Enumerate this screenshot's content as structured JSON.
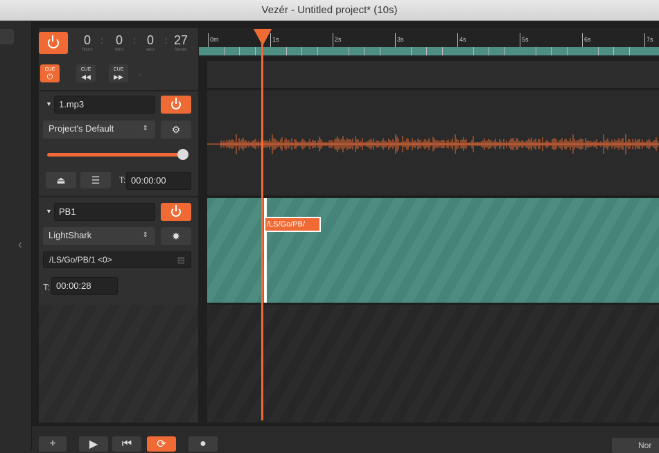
{
  "window": {
    "title": "Vezér - Untitled project* (10s)"
  },
  "transport": {
    "hours": "0",
    "mins": "0",
    "secs": "0",
    "frames": "27",
    "hours_label": "hours",
    "mins_label": "mins",
    "secs_label": "secs",
    "frames_label": "frames",
    "separator": ":"
  },
  "cue_buttons": [
    {
      "label": "CUE",
      "icon": "power-icon",
      "active": true
    },
    {
      "label": "CUE",
      "icon": "rewind-icon",
      "active": false
    },
    {
      "label": "CUE",
      "icon": "fast-forward-icon",
      "active": false
    }
  ],
  "cue_dash": "-",
  "ruler": {
    "labels": [
      "0m",
      "1s",
      "2s",
      "3s",
      "4s",
      "5s",
      "6s",
      "7s"
    ]
  },
  "audio_track": {
    "name": "1.mp3",
    "output": "Project's Default",
    "volume_fraction": 0.95,
    "offset_label": "T:",
    "offset": "00:00:00"
  },
  "osc_track": {
    "name": "PB1",
    "device": "LightShark",
    "address": "/LS/Go/PB/1 <0>",
    "offset_label": "T:",
    "offset": "00:00:28",
    "cue_tag": "/LS/Go/PB/"
  },
  "dropdown_arrows": "⇕",
  "bottom": {
    "right_button": "Nor"
  },
  "colors": {
    "accent": "#ef6a34",
    "clip": "#4c8c81",
    "background": "#1f1f1f"
  }
}
